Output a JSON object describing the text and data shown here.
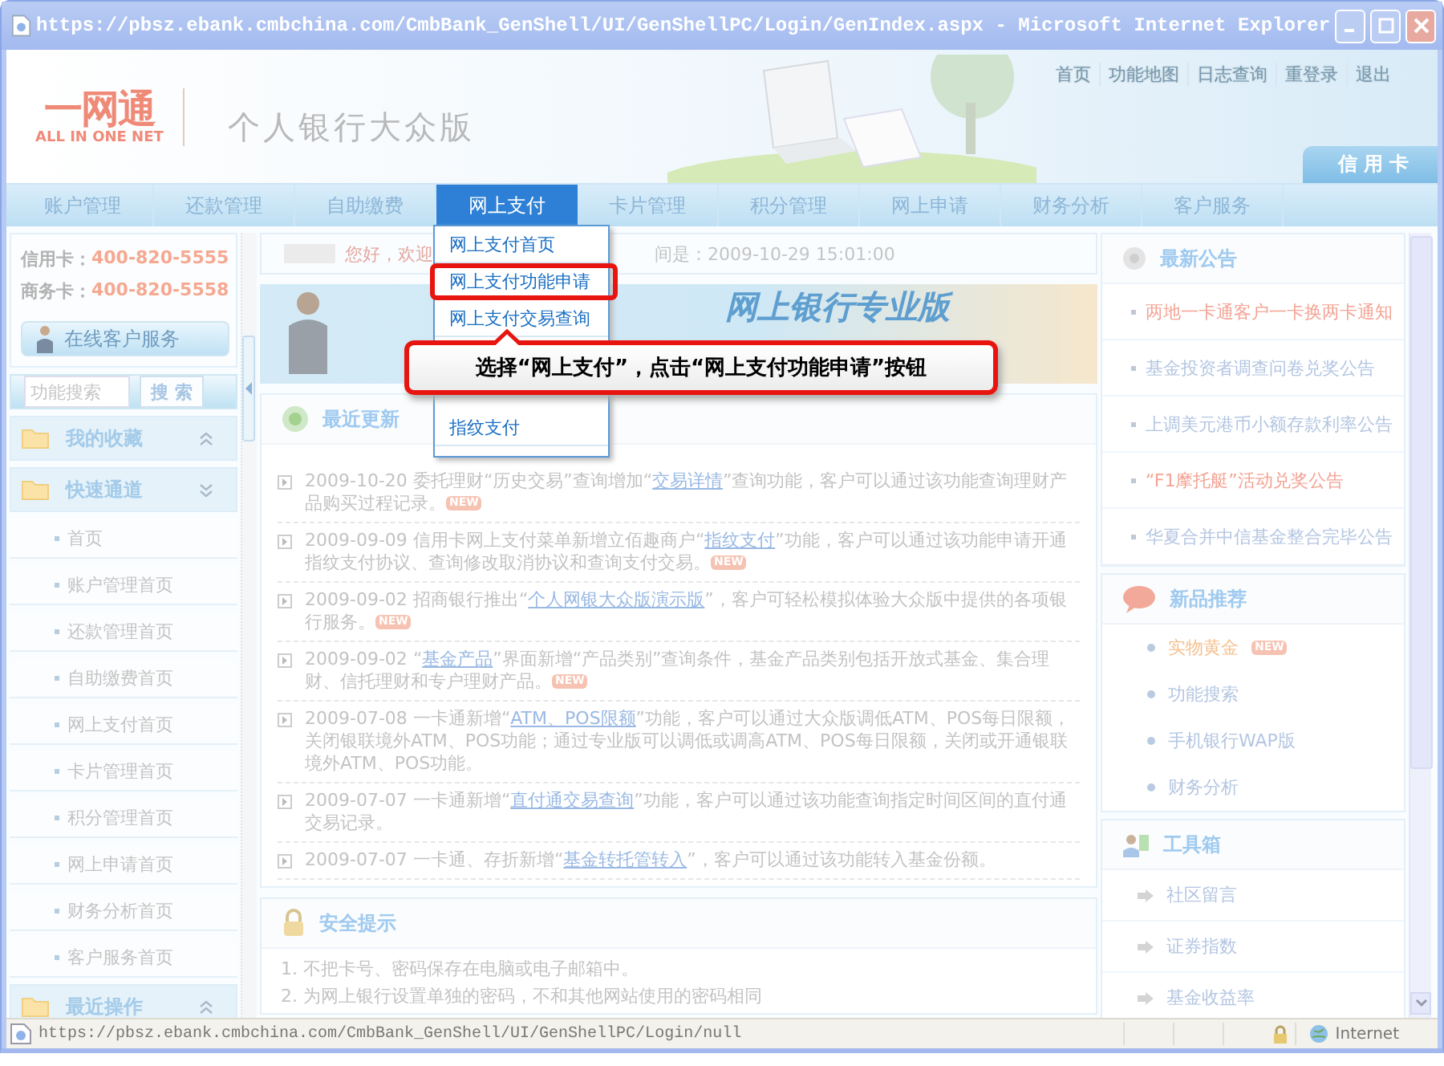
{
  "window": {
    "title": "https://pbsz.ebank.cmbchina.com/CmbBank_GenShell/UI/GenShellPC/Login/GenIndex.aspx - Microsoft Internet Explorer"
  },
  "header": {
    "links": [
      "首页",
      "功能地图",
      "日志查询",
      "重登录",
      "退出"
    ],
    "logo_cn": "一网通",
    "logo_en": "ALL IN ONE NET",
    "edition": "个人银行大众版",
    "card_tab": "信用卡"
  },
  "nav": [
    {
      "label": "账户管理",
      "selected": false
    },
    {
      "label": "还款管理",
      "selected": false
    },
    {
      "label": "自助缴费",
      "selected": false
    },
    {
      "label": "网上支付",
      "selected": true
    },
    {
      "label": "卡片管理",
      "selected": false
    },
    {
      "label": "积分管理",
      "selected": false
    },
    {
      "label": "网上申请",
      "selected": false
    },
    {
      "label": "财务分析",
      "selected": false
    },
    {
      "label": "客户服务",
      "selected": false
    }
  ],
  "dropdown": {
    "items": [
      {
        "label": "网上支付首页",
        "highlighted": false
      },
      {
        "label": "网上支付功能申请",
        "highlighted": true
      },
      {
        "label": "网上支付交易查询",
        "highlighted": false
      },
      {
        "label": "指纹支付",
        "highlighted": false
      }
    ]
  },
  "callout": "选择“网上支付”，点击“网上支付功能申请”按钮",
  "sidebar": {
    "hotlines": [
      {
        "label": "信用卡：",
        "number": "400-820-5555"
      },
      {
        "label": "商务卡：",
        "number": "400-820-5558"
      }
    ],
    "service_button": "在线客户服务",
    "search": {
      "placeholder": "功能搜索",
      "button": "搜 索"
    },
    "sections": [
      {
        "title": "我的收藏",
        "expanded": false
      },
      {
        "title": "快速通道",
        "expanded": true,
        "items": [
          "首页",
          "账户管理首页",
          "还款管理首页",
          "自助缴费首页",
          "网上支付首页",
          "卡片管理首页",
          "积分管理首页",
          "网上申请首页",
          "财务分析首页",
          "客户服务首页"
        ]
      },
      {
        "title": "最近操作",
        "expanded": false
      }
    ]
  },
  "greeting": {
    "text": "您好，欢迎",
    "time": "间是：2009-10-29 15:01:00"
  },
  "banner": {
    "text": "网上银行专业版"
  },
  "updates": {
    "title": "最近更新",
    "items": [
      {
        "date": "2009-10-20",
        "before": "委托理财“历史交易”查询增加“",
        "link": "交易详情",
        "after": "”查询功能，客户可以通过该功能查询理财产品购买过程记录。",
        "badge": "NEW"
      },
      {
        "date": "2009-09-09",
        "before": "信用卡网上支付菜单新增立佰趣商户“",
        "link": "指纹支付",
        "after": "”功能，客户可以通过该功能申请开通指纹支付协议、查询修改取消协议和查询支付交易。",
        "badge": "NEW"
      },
      {
        "date": "2009-09-02",
        "before": "招商银行推出“",
        "link": "个人网银大众版演示版",
        "after": "”，客户可轻松模拟体验大众版中提供的各项银行服务。",
        "badge": "NEW"
      },
      {
        "date": "2009-09-02",
        "before": "“",
        "link": "基金产品",
        "after": "”界面新增“产品类别”查询条件，基金产品类别包括开放式基金、集合理财、信托理财和专户理财产品。",
        "badge": "NEW"
      },
      {
        "date": "2009-07-08",
        "before": "一卡通新增“",
        "link": "ATM、POS限额",
        "after": "”功能，客户可以通过大众版调低ATM、POS每日限额，关闭银联境外ATM、POS功能；通过专业版可以调低或调高ATM、POS每日限额，关闭或开通银联境外ATM、POS功能。"
      },
      {
        "date": "2009-07-07",
        "before": "一卡通新增“",
        "link": "直付通交易查询",
        "after": "”功能，客户可以通过该功能查询指定时间区间的直付通交易记录。"
      },
      {
        "date": "2009-07-07",
        "before": "一卡通、存折新增“",
        "link": "基金转托管转入",
        "after": "”，客户可以通过该功能转入基金份额。"
      }
    ]
  },
  "security": {
    "title": "安全提示",
    "lines": [
      "1. 不把卡号、密码保存在电脑或电子邮箱中。",
      "2. 为网上银行设置单独的密码，不和其他网站使用的密码相同"
    ]
  },
  "announcements": {
    "title": "最新公告",
    "items": [
      {
        "text": "两地一卡通客户一卡换两卡通知",
        "highlight": true
      },
      {
        "text": "基金投资者调查问卷兑奖公告",
        "highlight": false
      },
      {
        "text": "上调美元港币小额存款利率公告",
        "highlight": false
      },
      {
        "text": "“F1摩托艇”活动兑奖公告",
        "highlight": true
      },
      {
        "text": "华夏合并中信基金整合完毕公告",
        "highlight": false
      }
    ]
  },
  "new_products": {
    "title": "新品推荐",
    "items": [
      {
        "text": "实物黄金",
        "highlight": true,
        "badge": "NEW"
      },
      {
        "text": "功能搜索",
        "highlight": false
      },
      {
        "text": "手机银行WAP版",
        "highlight": false
      },
      {
        "text": "财务分析",
        "highlight": false
      }
    ]
  },
  "toolbox": {
    "title": "工具箱",
    "items": [
      "社区留言",
      "证券指数",
      "基金收益率"
    ]
  },
  "status_bar": {
    "url": "https://pbsz.ebank.cmbchina.com/CmbBank_GenShell/UI/GenShellPC/Login/null",
    "zone": "Internet"
  }
}
